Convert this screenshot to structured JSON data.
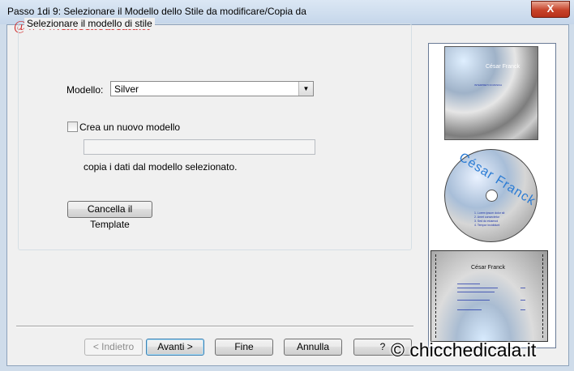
{
  "window": {
    "title": "Passo 1di 9: Selezionare il Modello dello Stile da modificare/Copia da",
    "close_glyph": "X"
  },
  "watermark_top": "@www.chicchedicala.it",
  "watermark_bottom": "© chicchedicala.it",
  "style_group": {
    "legend": "Selezionare il modello di stile",
    "model_label": "Modello:",
    "model_value": "Silver",
    "new_model_checkbox_label": "Crea un nuovo modello",
    "new_model_checked": false,
    "new_model_name_value": "",
    "copy_hint": "copia i dati dal modello selezionato.",
    "delete_template_button": "Cancella il Template"
  },
  "nav_buttons": {
    "back": "< Indietro",
    "next": "Avanti >",
    "finish": "Fine",
    "cancel": "Annulla",
    "help": "?"
  },
  "previews": {
    "cover_title": "César Franck",
    "cover_subtitle": "INTERPRETI DI MUSICA",
    "cd_title": "César Franck",
    "cd_lines": [
      "1. Lorem ipsum dolor sit",
      "2. Amet consectetur",
      "3. Sed do eiusmod",
      "4. Tempor incididunt"
    ],
    "back_title": "César Franck"
  },
  "colors": {
    "title_bar": "#dbe7f4",
    "close_button": "#c7432a",
    "dialog_bg": "#f0f0f0",
    "watermark_top": "#d02828"
  }
}
